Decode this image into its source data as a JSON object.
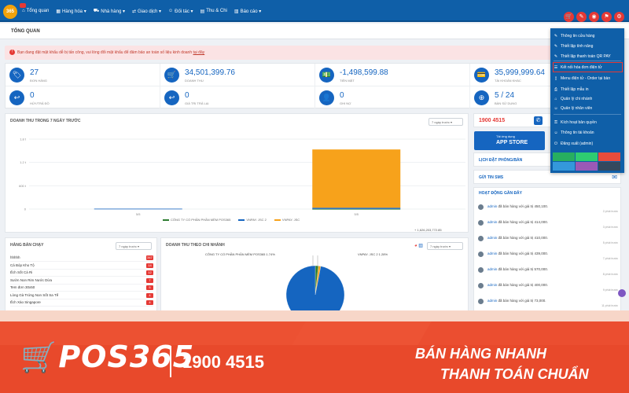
{
  "app": {
    "logo_text": "365",
    "page_title": "TỔNG QUAN"
  },
  "nav": [
    {
      "icon": "⌂",
      "label": "Tổng quan"
    },
    {
      "icon": "▦",
      "label": "Hàng hóa ▾"
    },
    {
      "icon": "⛟",
      "label": "Nhà hàng ▾"
    },
    {
      "icon": "⇄",
      "label": "Giao dịch ▾"
    },
    {
      "icon": "☺",
      "label": "Đối tác ▾"
    },
    {
      "icon": "▤",
      "label": "Thu & Chi"
    },
    {
      "icon": "▥",
      "label": "Báo cáo ▾"
    }
  ],
  "top_icons": [
    "🛒",
    "✎",
    "◉",
    "⚑",
    "⚙"
  ],
  "warning": {
    "text": "Bạn đang đặt mật khẩu dễ bị tấn công, vui lòng đổi mật khẩu để đảm bảo an toàn số liệu kinh doanh",
    "link": "tại đây"
  },
  "stats": [
    {
      "icon": "🏷",
      "value": "27",
      "label": "Đơn hàng"
    },
    {
      "icon": "🛒",
      "value": "34,501,399.76",
      "label": "Doanh thu"
    },
    {
      "icon": "💵",
      "value": "-1,498,599.88",
      "label": "Tiền mặt"
    },
    {
      "icon": "💳",
      "value": "35,999,999.64",
      "label": "Tài khoản khác"
    },
    {
      "icon": "↩",
      "value": "0",
      "label": "Hủy/Trả đồ"
    },
    {
      "icon": "↩",
      "value": "0",
      "label": "Giá trị trả lại"
    },
    {
      "icon": "👤",
      "value": "0",
      "label": "Ghi nợ"
    },
    {
      "icon": "⊕",
      "value": "5 / 24",
      "label": "Bàn sử dụng"
    }
  ],
  "revenue_chart": {
    "title": "DOANH THU TRONG 7 NGÀY TRƯỚC",
    "range_select": "7 ngày trước",
    "total_label": "+ 1,626,203,772.85"
  },
  "chart_data": [
    {
      "type": "bar",
      "title": "DOANH THU TRONG 7 NGÀY TRƯỚC",
      "categories": [
        "5/5",
        "5/5"
      ],
      "yticks": [
        "1.8 t",
        "1.2 t",
        "600 t",
        "0"
      ],
      "ylim": [
        0,
        1.8
      ],
      "series": [
        {
          "name": "CÔNG TY CỔ PHẦN PHẦN MỀM POS365",
          "color": "#2e7d32",
          "values": [
            0,
            0.004
          ]
        },
        {
          "name": "VNPAY. JSC 2",
          "color": "#1565c0",
          "values": [
            0.01,
            0.03
          ]
        },
        {
          "name": "VNPAY. JSC",
          "color": "#f7a21b",
          "values": [
            0,
            1.5
          ]
        }
      ],
      "legend": "bottom"
    },
    {
      "type": "pie",
      "title": "DOANH THU THEO CHI NHÁNH",
      "slices": [
        {
          "name": "CÔNG TY CỔ PHẦN PHẦN MỀM POS365",
          "value": 1.74,
          "color": "#2e7d32"
        },
        {
          "name": "VNPAY. JSC 2",
          "value": 1.28,
          "color": "#f7a21b"
        },
        {
          "name": "VNPAY. JSC",
          "value": 96.98,
          "color": "#1565c0"
        }
      ]
    }
  ],
  "pie_labels": {
    "left": "CÔNG TY CỔ PHẦN PHẦN MỀM POS365 1.74%",
    "right": "VNPAY. JSC 2 1.28%"
  },
  "hot_items": {
    "title": "HÀNG BÁN CHẠY",
    "range_select": "7 ngày trước",
    "rows": [
      {
        "name": "hhhhh",
        "count": "347"
      },
      {
        "name": "Cá Bóp Kho Tộ",
        "count": "14"
      },
      {
        "name": "Ếch Sốt Cà Ri",
        "count": "12"
      },
      {
        "name": "Sườn Non Rim Nước Dừa",
        "count": "7"
      },
      {
        "name": "Tem đơn 30x50",
        "count": "5"
      },
      {
        "name": "Lòng Gà Trứng Non Sốt Sa Tế",
        "count": "4"
      },
      {
        "name": "Ếch Xào Singapore",
        "count": "4"
      }
    ]
  },
  "branch_chart": {
    "title": "DOANH THU THEO CHI NHÁNH",
    "range_select": "7 ngày trước"
  },
  "right_panel": {
    "hotline": "1900 4515",
    "app_store_small": "Tải ứng dụng",
    "app_store_big": "APP STORE",
    "booking_title": "LỊCH ĐẶT PHÒNG/BÀN",
    "sms_title": "GỬI TIN SMS",
    "activity_title": "HOẠT ĐỘNG GẦN ĐÂY",
    "activities": [
      {
        "user": "admin",
        "text": "đã bán hàng với giá trị 450,100.",
        "time": "2 phút trước"
      },
      {
        "user": "admin",
        "text": "đã bán hàng với giá trị 414,000.",
        "time": "3 phút trước"
      },
      {
        "user": "admin",
        "text": "đã bán hàng với giá trị 410,000.",
        "time": "5 phút trước"
      },
      {
        "user": "admin",
        "text": "đã bán hàng với giá trị 439,000.",
        "time": "7 phút trước"
      },
      {
        "user": "admin",
        "text": "đã bán hàng với giá trị 570,000.",
        "time": "8 phút trước"
      },
      {
        "user": "admin",
        "text": "đã bán hàng với giá trị 400,000.",
        "time": "9 phút trước"
      },
      {
        "user": "admin",
        "text": "đã bán hàng với giá trị 73,000.",
        "time": "11 phút trước"
      }
    ]
  },
  "dropdown": {
    "items": [
      {
        "icon": "✎",
        "label": "Thông tin cửa hàng"
      },
      {
        "icon": "✎",
        "label": "Thiết lập tính năng"
      },
      {
        "icon": "✎",
        "label": "Thiết lập thanh toán QR PAY"
      },
      {
        "icon": "☰",
        "label": "Kết nối hóa đơn điện tử"
      },
      {
        "icon": "▯",
        "label": "Menu điện tử - Order tại bàn"
      },
      {
        "icon": "⎙",
        "label": "Thiết lập mẫu in"
      },
      {
        "icon": "⌂",
        "label": "Quản lý chi nhánh"
      },
      {
        "icon": "☺",
        "label": "Quản lý nhân viên"
      },
      {
        "icon": "⚿",
        "label": "Kích hoạt bản quyền"
      },
      {
        "icon": "☺",
        "label": "Thông tin tài khoản"
      },
      {
        "icon": "⏻",
        "label": "Đăng xuất (admin)"
      }
    ],
    "swatches": [
      "#27ae60",
      "#2ecc71",
      "#e74c3c",
      "#3498db",
      "#9b59b6",
      "#34495e"
    ]
  },
  "banner": {
    "brand": "POS365",
    "hotline": "1900 4515",
    "slogan1": "BÁN HÀNG NHANH",
    "slogan2": "THANH TOÁN CHUẨN"
  }
}
